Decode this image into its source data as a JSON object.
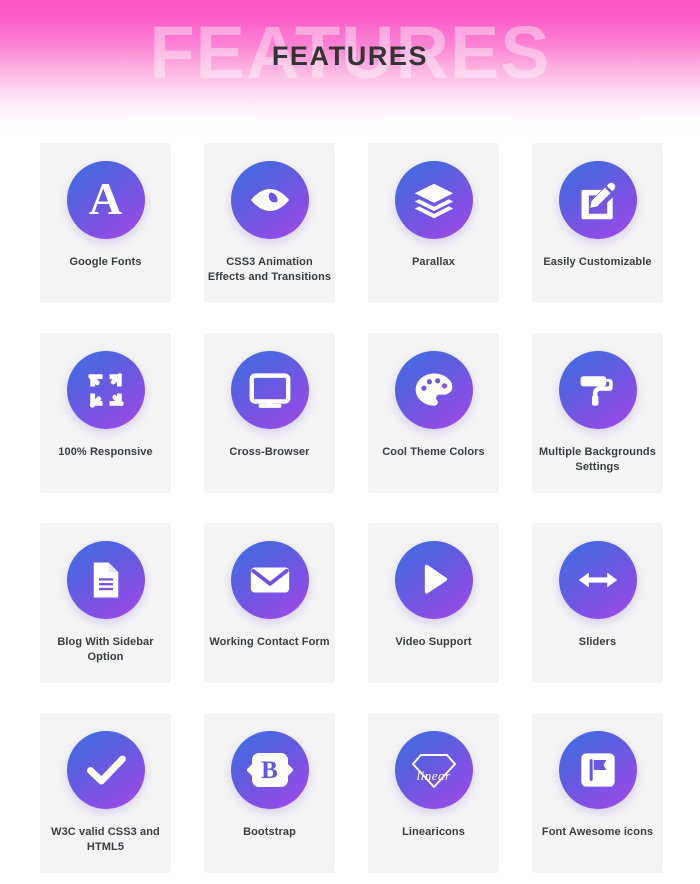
{
  "header": {
    "title": "FEATURES",
    "watermark": "FEATURES",
    "gradient_top": "#fb55c6",
    "gradient_bottom": "#ffffff",
    "title_color": "#333437"
  },
  "theme": {
    "card_background": "#f4f4f5",
    "icon_gradient_start": "#3d6fe4",
    "icon_gradient_end": "#a24ae9",
    "label_color": "#3c3d41"
  },
  "features": [
    {
      "label": "Google Fonts",
      "icon": "letter-a-icon"
    },
    {
      "label": "CSS3 Animation Effects and Transitions",
      "icon": "eye-icon"
    },
    {
      "label": "Parallax",
      "icon": "layers-icon"
    },
    {
      "label": "Easily Customizable",
      "icon": "edit-pencil-square-icon"
    },
    {
      "label": "100% Responsive",
      "icon": "expand-arrows-icon"
    },
    {
      "label": "Cross-Browser",
      "icon": "desktop-monitor-icon"
    },
    {
      "label": "Cool Theme Colors",
      "icon": "palette-icon"
    },
    {
      "label": "Multiple Backgrounds Settings",
      "icon": "paint-roller-icon"
    },
    {
      "label": "Blog With Sidebar Option",
      "icon": "document-lines-icon"
    },
    {
      "label": "Working Contact Form",
      "icon": "envelope-icon"
    },
    {
      "label": "Video Support",
      "icon": "play-triangle-icon"
    },
    {
      "label": "Sliders",
      "icon": "arrows-horizontal-icon"
    },
    {
      "label": "W3C valid CSS3 and HTML5",
      "icon": "checkmark-icon"
    },
    {
      "label": "Bootstrap",
      "icon": "bootstrap-b-icon"
    },
    {
      "label": "Linearicons",
      "icon": "linearicons-diamond-icon"
    },
    {
      "label": "Font Awesome icons",
      "icon": "flag-square-icon"
    }
  ],
  "linearicons_wordmark": "linear"
}
